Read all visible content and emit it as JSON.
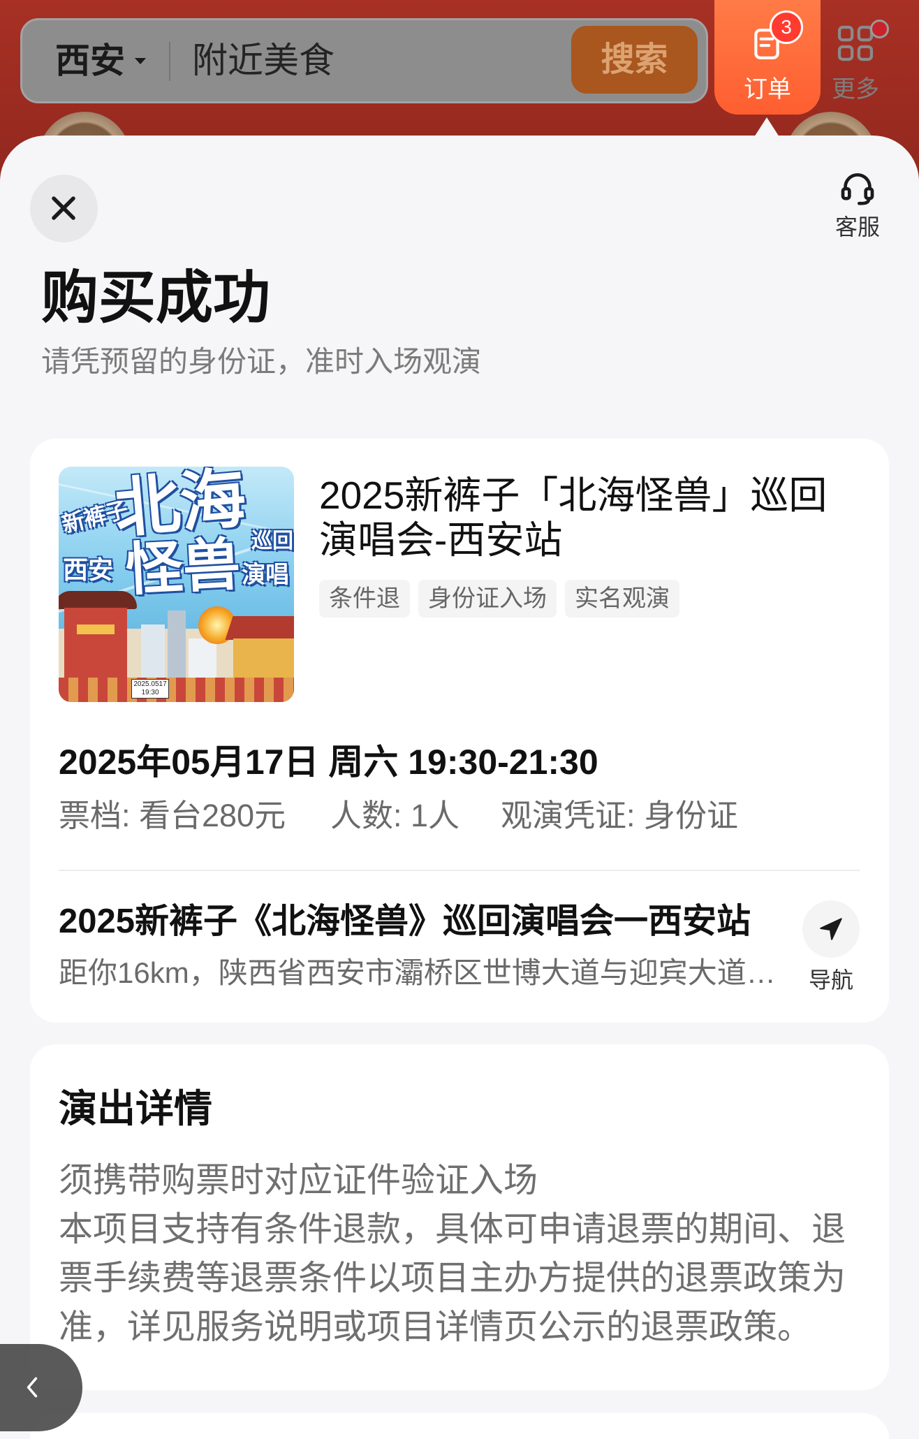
{
  "header": {
    "city": "西安",
    "search_text": "附近美食",
    "search_button": "搜索",
    "orders_label": "订单",
    "orders_badge": "3",
    "more_label": "更多"
  },
  "sheet": {
    "customer_service_label": "客服",
    "title": "购买成功",
    "subtitle": "请凭预留的身份证，准时入场观演"
  },
  "order_card": {
    "poster": {
      "lettering": [
        "新裤子",
        "北海",
        "怪兽",
        "西安",
        "巡回",
        "演唱"
      ],
      "date_tag": "2025.0517",
      "time_tag": "19:30"
    },
    "event_title": "2025新裤子「北海怪兽」巡回演唱会-西安站",
    "tags": [
      "条件退",
      "身份证入场",
      "实名观演"
    ],
    "datetime": "2025年05月17日 周六 19:30-21:30",
    "ticket_tier": "票档: 看台280元",
    "headcount": "人数: 1人",
    "credential": "观演凭证: 身份证",
    "venue_name": "2025新裤子《北海怪兽》巡回演唱会一西安站",
    "venue_address": "距你16km，陕西省西安市灞桥区世博大道与迎宾大道…",
    "navigate_label": "导航"
  },
  "details_card": {
    "heading": "演出详情",
    "paragraphs": [
      "须携带购票时对应证件验证入场",
      "本项目支持有条件退款，具体可申请退票的期间、退票手续费等退票条件以项目主办方提供的退票政策为准，详见服务说明或项目详情页公示的退票政策。"
    ]
  },
  "colors": {
    "banner_red": "#a83024",
    "orders_accent": "#ff6a3a",
    "badge_red": "#ff3b30",
    "sheet_background": "#f6f6f8",
    "card_background": "#ffffff",
    "primary_text": "#111111",
    "secondary_text": "#6a6a6a"
  },
  "icons": {
    "city_dropdown": "chevron-down-icon",
    "orders": "document-icon",
    "more": "grid-icon",
    "close": "close-icon",
    "customer_service": "headset-icon",
    "navigate": "navigation-arrow-icon",
    "back": "chevron-left-icon"
  }
}
